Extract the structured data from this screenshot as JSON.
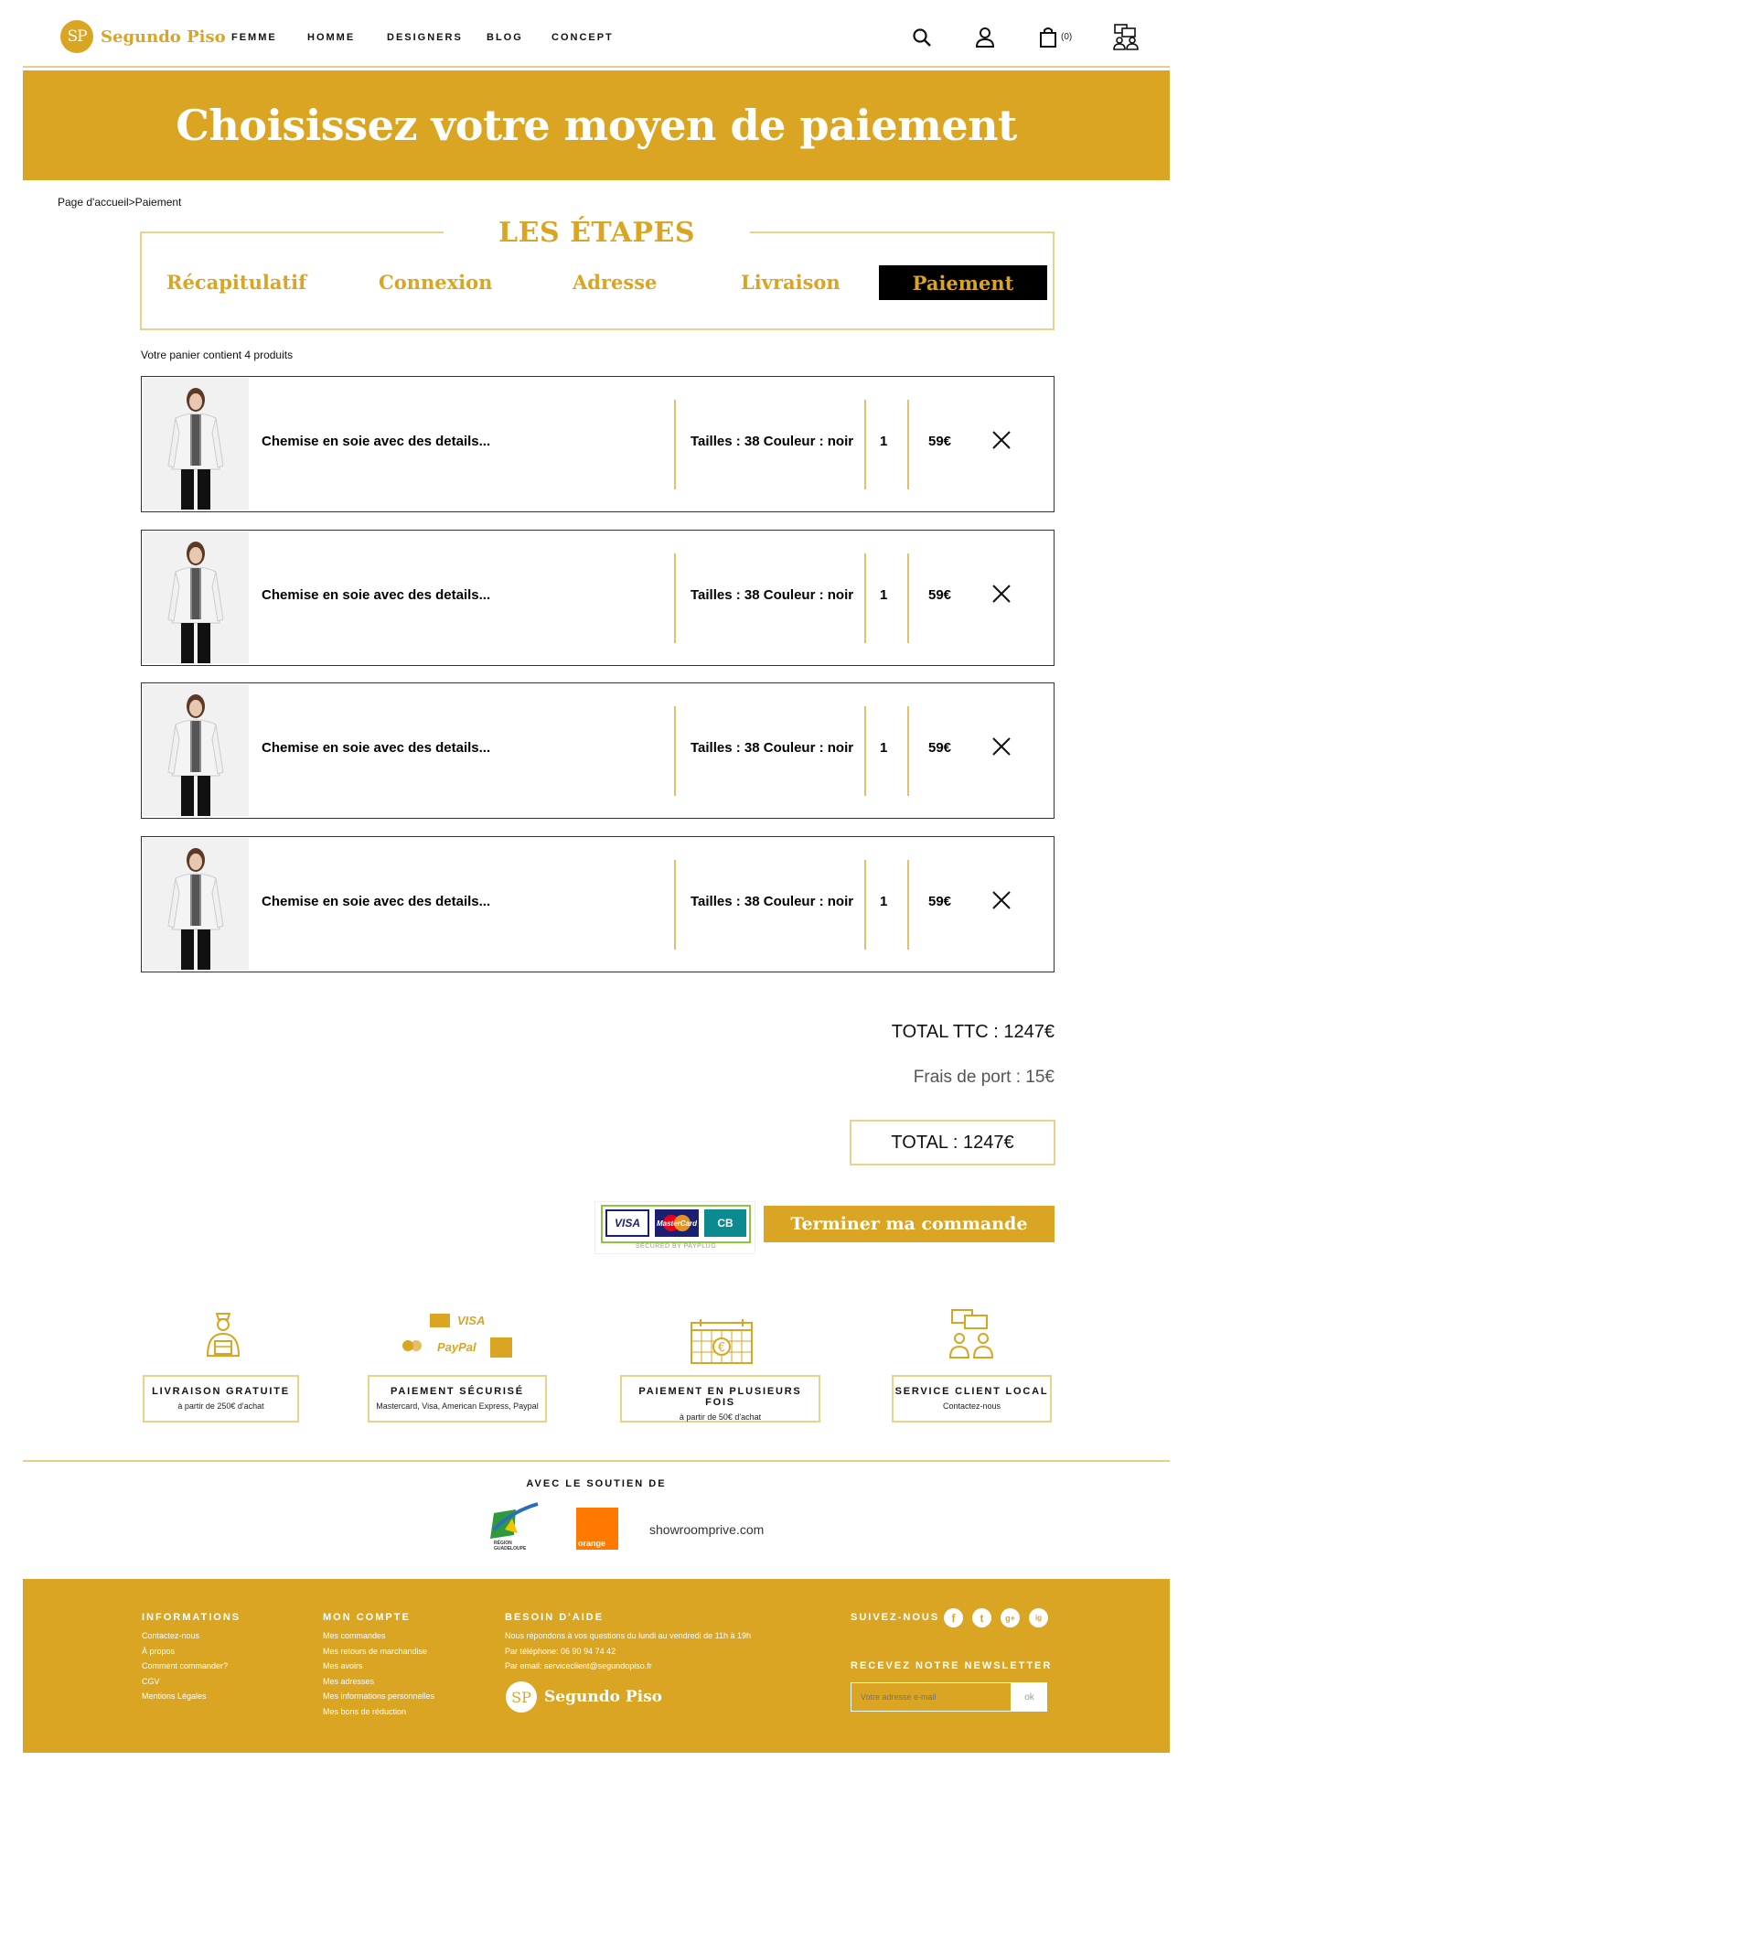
{
  "header": {
    "brand": "Segundo Piso",
    "brand_mark": "SP",
    "nav": [
      "FEMME",
      "HOMME",
      "DESIGNERS",
      "BLOG",
      "CONCEPT"
    ],
    "cart_count": "(0)",
    "icons": [
      "search-icon",
      "user-icon",
      "cart-icon",
      "chat-users-icon"
    ]
  },
  "banner": {
    "title": "Choisissez votre moyen de paiement"
  },
  "breadcrumb": "Page d'accueil>Paiement",
  "steps": {
    "title": "LES ÉTAPES",
    "items": [
      "Récapitulatif",
      "Connexion",
      "Adresse",
      "Livraison",
      "Paiement"
    ],
    "active": "Paiement"
  },
  "cart": {
    "summary": "Votre panier contient 4 produits",
    "items": [
      {
        "name": "Chemise en soie avec des details...",
        "attributes": "Tailles : 38 Couleur : noir",
        "qty": "1",
        "price": "59€"
      },
      {
        "name": "Chemise en soie avec des details...",
        "attributes": "Tailles : 38 Couleur : noir",
        "qty": "1",
        "price": "59€"
      },
      {
        "name": "Chemise en soie avec des details...",
        "attributes": "Tailles : 38 Couleur : noir",
        "qty": "1",
        "price": "59€"
      },
      {
        "name": "Chemise en soie avec des details...",
        "attributes": "Tailles : 38 Couleur : noir",
        "qty": "1",
        "price": "59€"
      }
    ]
  },
  "totals": {
    "ttc": "TOTAL TTC : 1247€",
    "shipping": "Frais de port : 15€",
    "total": "TOTAL : 1247€"
  },
  "payment": {
    "cards": [
      "VISA",
      "MasterCard",
      "CB"
    ],
    "secured": "SECURED BY PAYPLUG",
    "finish_label": "Terminer ma commande"
  },
  "features": [
    {
      "title": "LIVRAISON GRATUITE",
      "sub": "à partir de 250€ d'achat",
      "icon": "delivery-icon"
    },
    {
      "title": "PAIEMENT SÉCURISÉ",
      "sub": "Mastercard, Visa, American Express, Paypal",
      "icon": "payment-cards-icon",
      "icon_labels": [
        "VISA",
        "PayPal"
      ]
    },
    {
      "title": "PAIEMENT EN PLUSIEURS FOIS",
      "sub": "à partir de 50€ d'achat",
      "icon": "calendar-euro-icon"
    },
    {
      "title": "SERVICE CLIENT LOCAL",
      "sub": "Contactez-nous",
      "icon": "customer-service-icon"
    }
  ],
  "support": {
    "title": "AVEC LE SOUTIEN DE",
    "partners": [
      "RÉGION GUADELOUPE",
      "orange",
      "showroomprive.com"
    ]
  },
  "footer": {
    "informations": {
      "title": "INFORMATIONS",
      "links": [
        "Contactez-nous",
        "À propos",
        "Comment commander?",
        "CGV",
        "Mentions Légales"
      ]
    },
    "account": {
      "title": "MON COMPTE",
      "links": [
        "Mes commandes",
        "Mes retours de marchandise",
        "Mes avoirs",
        "Mes adresses",
        "Mes informations personnelles",
        "Mes bons de réduction"
      ]
    },
    "help": {
      "title": "BESOIN D'AIDE",
      "lines": [
        "Nous répondons à vos questions du lundi au vendredi de 11h à 19h",
        "Par téléphone: 06 90 94 74 42",
        "Par email: serviceclient@segundopiso.fr"
      ]
    },
    "follow": {
      "title": "SUIVEZ-NOUS",
      "networks": [
        "f",
        "t",
        "g+",
        "ig"
      ]
    },
    "newsletter": {
      "title": "RECEVEZ NOTRE NEWSLETTER",
      "placeholder": "Votre adresse e-mail",
      "button": "ok"
    }
  },
  "colors": {
    "accent": "#d9a523",
    "accent_light": "#ecd18a"
  }
}
